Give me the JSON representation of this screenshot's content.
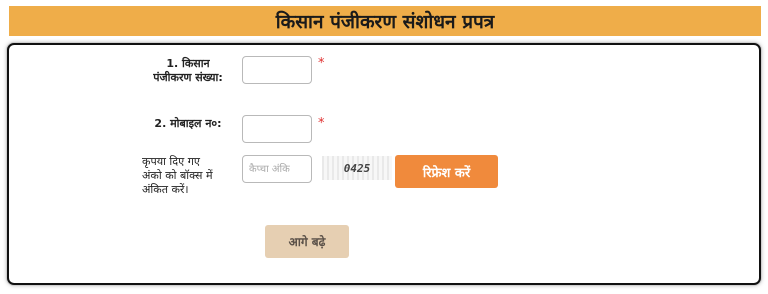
{
  "page": {
    "title": "किसान पंजीकरण संशोधन प्रपत्र"
  },
  "form": {
    "farmer_reg_label_line1": "1. किसान",
    "farmer_reg_label_line2": "पंजीकरण संख्या:",
    "farmer_reg_value": "",
    "required_mark": "*",
    "mobile_label": "2. मोबाइल न०:",
    "mobile_value": "",
    "captcha_label_line1": "कृपया दिए गए",
    "captcha_label_line2": "अंको को बॉक्स में",
    "captcha_label_line3": "अंकित करें।",
    "captcha_placeholder": "कैप्चा अंकि",
    "captcha_code": "0425",
    "refresh_label": "रिफ्रेश  करें",
    "next_label": "आगे बढ़े"
  },
  "colors": {
    "title_bar": "#efad49",
    "refresh_button": "#f08a3c",
    "next_button": "#e6cfb2",
    "required": "#e03030"
  }
}
